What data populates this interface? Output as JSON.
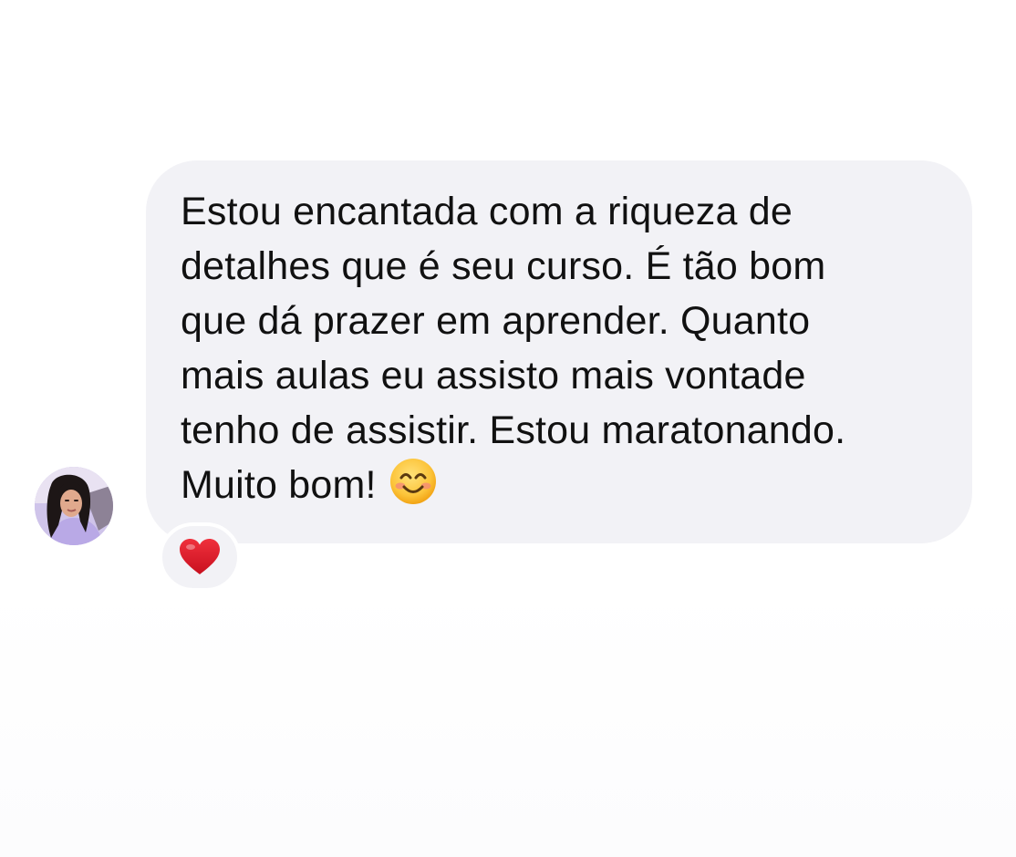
{
  "message": {
    "lines": [
      "Estou encantada com a riqueza de",
      "detalhes que é seu curso. É tão bom",
      "que dá prazer em aprender. Quanto",
      "mais aulas eu assisto mais vontade",
      "tenho de assistir. Estou maratonando.",
      "Muito bom!"
    ],
    "emoji_icon": "smiling-face-icon",
    "bubble_color": "#f2f2f6",
    "text_color": "#111111"
  },
  "reaction": {
    "icon": "red-heart-icon",
    "color": "#e0202e"
  },
  "sender": {
    "avatar_icon": "user-avatar-photo"
  }
}
